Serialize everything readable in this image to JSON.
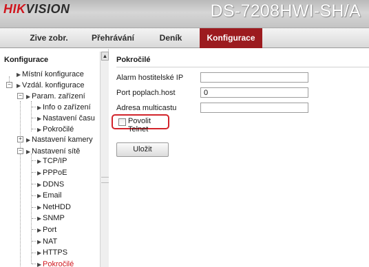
{
  "header": {
    "logo_hik": "HIK",
    "logo_vision": "VISION",
    "model": "DS-7208HWI-SH/A",
    "logo_color": "#d0141c"
  },
  "nav": {
    "tabs": [
      {
        "label": "Zive zobr."
      },
      {
        "label": "Přehrávání"
      },
      {
        "label": "Deník"
      },
      {
        "label": "Konfigurace",
        "active": true
      }
    ],
    "active_color": "#9c1b1f"
  },
  "sidebar": {
    "title": "Konfigurace",
    "items": [
      {
        "label": "Místní konfigurace"
      },
      {
        "label": "Vzdál. konfigurace",
        "expanded": true
      },
      {
        "label": "Param. zařízení",
        "expanded": true
      },
      {
        "label": "Info o zařízení"
      },
      {
        "label": "Nastavení času"
      },
      {
        "label": "Pokročilé"
      },
      {
        "label": "Nastavení kamery",
        "expanded": false
      },
      {
        "label": "Nastavení sítě",
        "expanded": true
      },
      {
        "label": "TCP/IP"
      },
      {
        "label": "PPPoE"
      },
      {
        "label": "DDNS"
      },
      {
        "label": "Email"
      },
      {
        "label": "NetHDD"
      },
      {
        "label": "SNMP"
      },
      {
        "label": "Port"
      },
      {
        "label": "NAT"
      },
      {
        "label": "HTTPS"
      },
      {
        "label": "Pokročilé",
        "selected": true
      }
    ]
  },
  "main": {
    "title": "Pokročilé",
    "fields": [
      {
        "label": "Alarm hostitelské IP",
        "value": ""
      },
      {
        "label": "Port poplach.host",
        "value": "0"
      },
      {
        "label": "Adresa multicastu",
        "value": ""
      }
    ],
    "telnet": {
      "label": "Povolit Telnet",
      "checked": false,
      "highlight_color": "#d2232a"
    },
    "save_label": "Uložit"
  }
}
